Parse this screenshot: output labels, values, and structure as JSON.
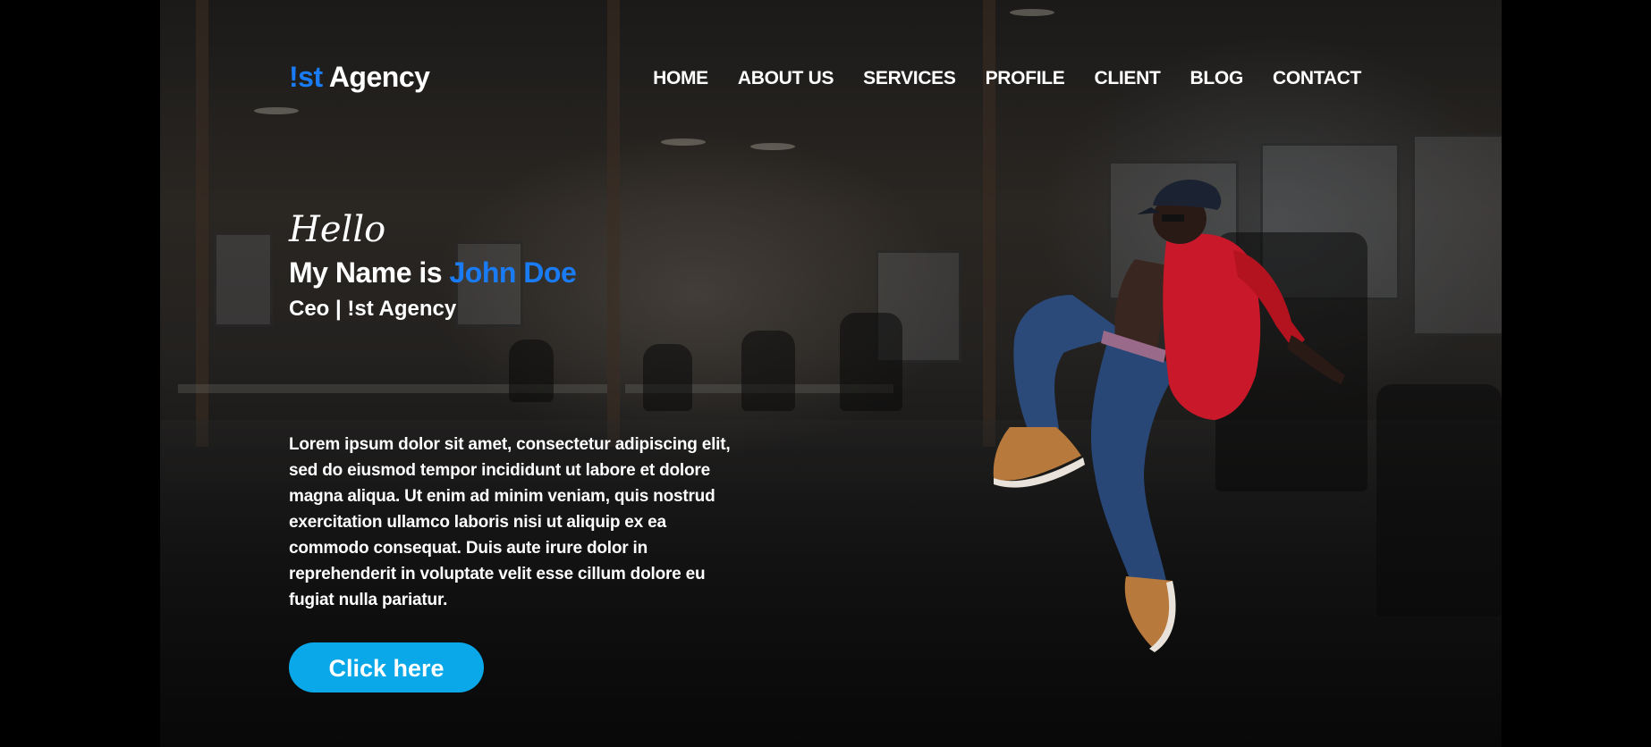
{
  "header": {
    "logo_accent": "!st",
    "logo_text": "Agency",
    "nav": [
      "HOME",
      "ABOUT US",
      "SERVICES",
      "PROFILE",
      "CLIENT",
      "BLOG",
      "CONTACT"
    ]
  },
  "hero": {
    "greeting": "Hello",
    "name_prefix": "My Name is",
    "name": "John Doe",
    "role": "Ceo | !st Agency",
    "bio": "Lorem ipsum dolor sit amet, consectetur adipiscing elit, sed do eiusmod tempor incididunt ut labore et dolore magna aliqua. Ut enim ad minim veniam, quis nostrud exercitation ullamco laboris nisi ut aliquip ex ea commodo consequat. Duis aute irure dolor in reprehenderit in voluptate velit esse cillum dolore eu fugiat nulla pariatur.",
    "cta_label": "Click here"
  },
  "colors": {
    "accent": "#1a7cf5",
    "button": "#0aa8e8",
    "background": "#1b1a19",
    "text": "#ffffff"
  }
}
